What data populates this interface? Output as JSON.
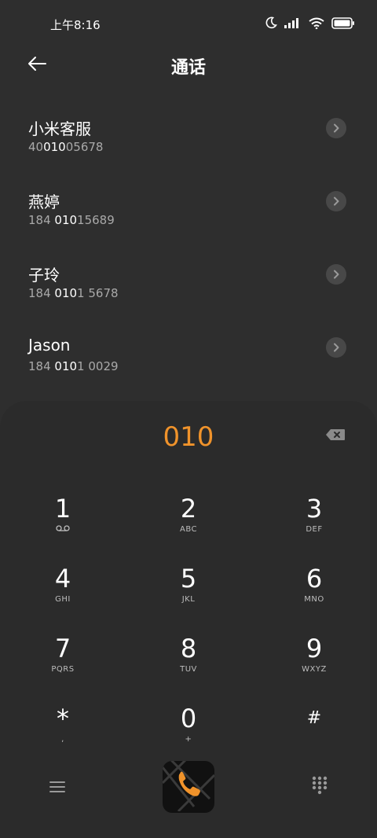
{
  "status": {
    "time": "上午8:16",
    "icons": [
      "moon-icon",
      "signal-icon",
      "wifi-icon",
      "battery-icon"
    ]
  },
  "header": {
    "title": "通话",
    "back_icon": "back-arrow-icon"
  },
  "contacts": [
    {
      "name": "小米客服",
      "number_prefix": "40",
      "number_match": "010",
      "number_suffix": "05678"
    },
    {
      "name": "燕婷",
      "number_prefix": "184 ",
      "number_match": "010",
      "number_suffix": "15689"
    },
    {
      "name": "子玲",
      "number_prefix": "184 ",
      "number_match": "010",
      "number_suffix": "1 5678"
    },
    {
      "name": "Jason",
      "number_prefix": "184 ",
      "number_match": "010",
      "number_suffix": "1 0029"
    }
  ],
  "dialpad": {
    "input": "010",
    "keys": [
      {
        "digit": "1",
        "letters": ""
      },
      {
        "digit": "2",
        "letters": "ABC"
      },
      {
        "digit": "3",
        "letters": "DEF"
      },
      {
        "digit": "4",
        "letters": "GHI"
      },
      {
        "digit": "5",
        "letters": "JKL"
      },
      {
        "digit": "6",
        "letters": "MNO"
      },
      {
        "digit": "7",
        "letters": "PQRS"
      },
      {
        "digit": "8",
        "letters": "TUV"
      },
      {
        "digit": "9",
        "letters": "WXYZ"
      },
      {
        "digit": "*",
        "letters": ","
      },
      {
        "digit": "0",
        "letters": "+"
      },
      {
        "digit": "#",
        "letters": ""
      }
    ]
  },
  "colors": {
    "background": "#2e2e2e",
    "accent": "#f0932b",
    "secondary_text": "#a9a9a9"
  }
}
